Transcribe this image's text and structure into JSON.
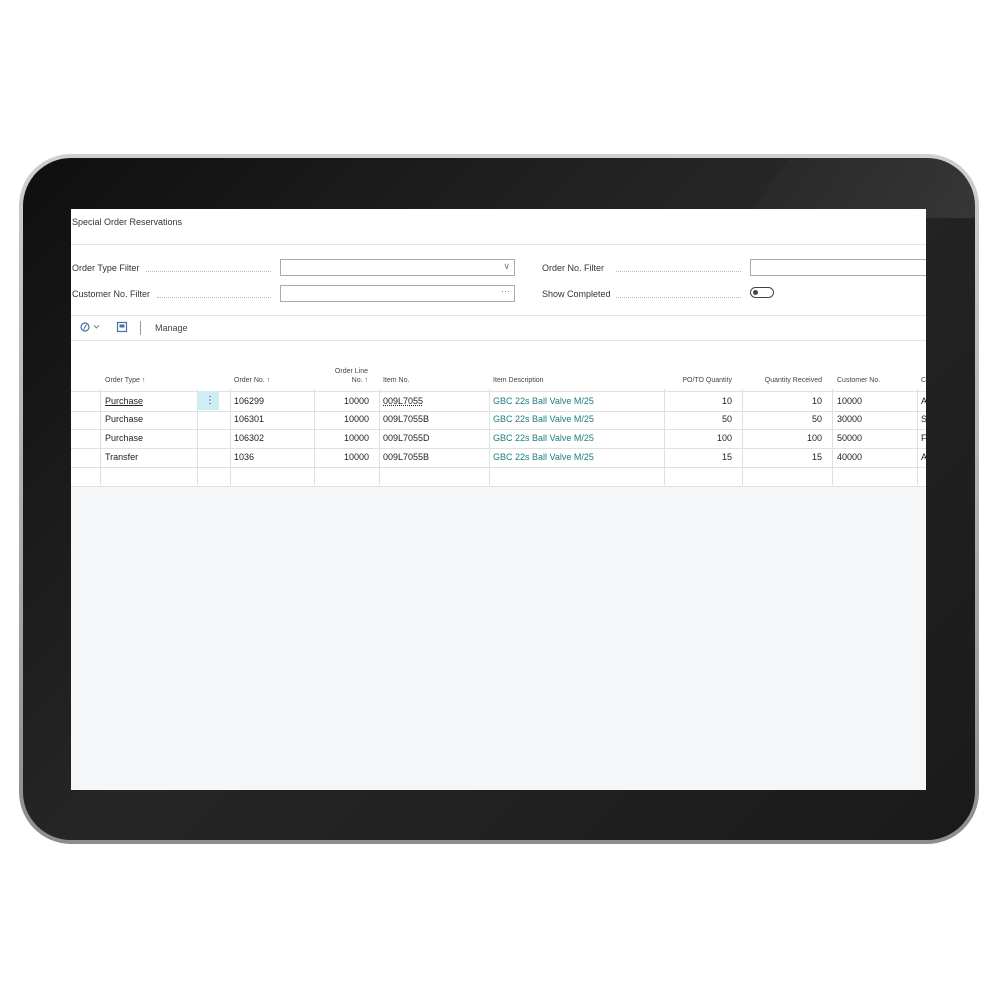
{
  "page": {
    "title": "Special Order Reservations"
  },
  "filters": {
    "order_type": {
      "label": "Order Type Filter",
      "value": ""
    },
    "customer_no": {
      "label": "Customer No. Filter",
      "value": ""
    },
    "order_no": {
      "label": "Order No. Filter",
      "value": ""
    },
    "show_completed": {
      "label": "Show Completed",
      "value": false
    }
  },
  "actions": {
    "manage_label": "Manage"
  },
  "table": {
    "columns": {
      "order_type": "Order Type ↑",
      "order_no": "Order No. ↑",
      "order_line_no_1": "Order Line",
      "order_line_no_2": "No. ↑",
      "item_no": "Item No.",
      "item_description": "Item Description",
      "po_to_quantity": "PO/TO Quantity",
      "quantity_received": "Quantity Received",
      "customer_no": "Customer No.",
      "next": "C"
    },
    "rows": [
      {
        "order_type": "Purchase",
        "order_no": "106299",
        "order_line_no": "10000",
        "item_no": "009L7055",
        "item_description": "GBC 22s Ball Valve M/25",
        "po_to_quantity": "10",
        "quantity_received": "10",
        "customer_no": "10000",
        "next": "A"
      },
      {
        "order_type": "Purchase",
        "order_no": "106301",
        "order_line_no": "10000",
        "item_no": "009L7055B",
        "item_description": "GBC 22s Ball Valve M/25",
        "po_to_quantity": "50",
        "quantity_received": "50",
        "customer_no": "30000",
        "next": "S"
      },
      {
        "order_type": "Purchase",
        "order_no": "106302",
        "order_line_no": "10000",
        "item_no": "009L7055D",
        "item_description": "GBC 22s Ball Valve M/25",
        "po_to_quantity": "100",
        "quantity_received": "100",
        "customer_no": "50000",
        "next": "F"
      },
      {
        "order_type": "Transfer",
        "order_no": "1036",
        "order_line_no": "10000",
        "item_no": "009L7055B",
        "item_description": "GBC 22s Ball Valve M/25",
        "po_to_quantity": "15",
        "quantity_received": "15",
        "customer_no": "40000",
        "next": "A"
      }
    ]
  },
  "icons": {
    "row_menu": "⋮",
    "dropdown": "∨",
    "lookup": "···"
  },
  "colors": {
    "link": "#1e7d7d",
    "selected_cell": "#cdeef5"
  }
}
